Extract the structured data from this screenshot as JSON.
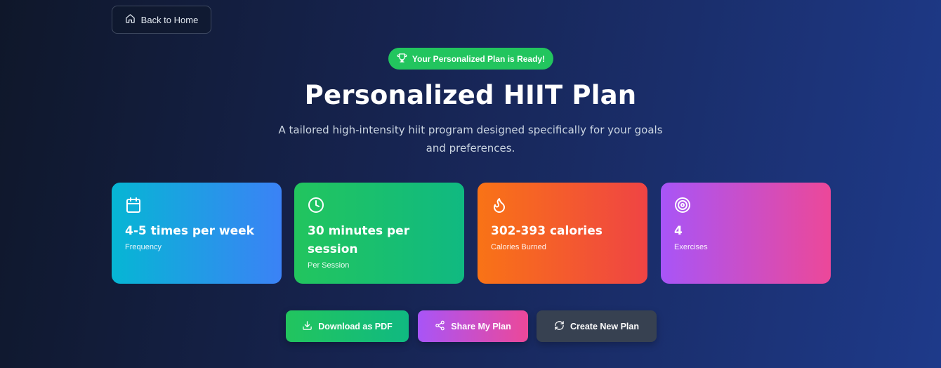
{
  "nav": {
    "back_label": "Back to Home",
    "back_icon": "home-icon"
  },
  "hero": {
    "badge_label": "Your Personalized Plan is Ready!",
    "badge_icon": "trophy-icon",
    "title": "Personalized HIIT Plan",
    "subtitle": "A tailored high-intensity hiit program designed specifically for your goals and preferences."
  },
  "stats": [
    {
      "icon": "calendar-icon",
      "value": "4-5 times per week",
      "label": "Frequency"
    },
    {
      "icon": "clock-icon",
      "value": "30 minutes per session",
      "label": "Per Session"
    },
    {
      "icon": "flame-icon",
      "value": "302-393 calories",
      "label": "Calories Burned"
    },
    {
      "icon": "target-icon",
      "value": "4",
      "label": "Exercises"
    }
  ],
  "actions": {
    "download_label": "Download as PDF",
    "share_label": "Share My Plan",
    "create_label": "Create New Plan"
  },
  "colors": {
    "badge": "#22c55e",
    "frequency_card": [
      "#06b6d4",
      "#3b82f6"
    ],
    "session_card": [
      "#22c55e",
      "#10b981"
    ],
    "calories_card": [
      "#f97316",
      "#ef4444"
    ],
    "exercises_card": [
      "#a855f7",
      "#ec4899"
    ],
    "create_button": "#374151"
  }
}
